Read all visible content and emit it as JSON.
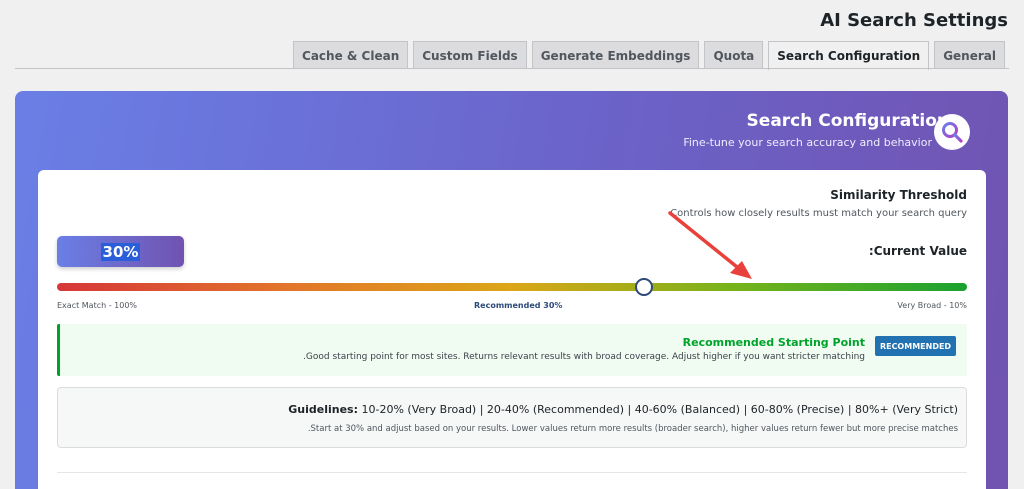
{
  "page": {
    "title": "AI Search Settings"
  },
  "tabs": [
    {
      "label": "Cache & Clean",
      "active": false
    },
    {
      "label": "Custom Fields",
      "active": false
    },
    {
      "label": "Generate Embeddings",
      "active": false
    },
    {
      "label": "Quota",
      "active": false
    },
    {
      "label": "Search Configuration",
      "active": true
    },
    {
      "label": "General",
      "active": false
    }
  ],
  "card": {
    "title": "Search Configuration",
    "subtitle": "Fine-tune your search accuracy and behavior",
    "icon": "search-icon"
  },
  "threshold": {
    "title": "Similarity Threshold",
    "description": "Controls how closely results must match your search query",
    "current_value_label": ":Current Value",
    "value_display": "30%",
    "value": 30,
    "min_label": "Exact Match - 100%",
    "recommended_label": "Recommended 30%",
    "max_label": "Very Broad - 10%"
  },
  "recommendation": {
    "title": "Recommended Starting Point",
    "description": ".Good starting point for most sites. Returns relevant results with broad coverage. Adjust higher if you want stricter matching",
    "badge": "RECOMMENDED"
  },
  "guidelines": {
    "label": "Guidelines:",
    "text": "10-20% (Very Broad) | 20-40% (Recommended) | 40-60% (Balanced) | 60-80% (Precise) | 80%+ (Very Strict)",
    "description": ".Start at 30% and adjust based on your results. Lower values return more results (broader search), higher values return fewer but more precise matches"
  },
  "colors": {
    "accent_start": "#6a7fe6",
    "accent_end": "#7153b0",
    "success": "#00a32a",
    "primary": "#2271b1",
    "annotation_arrow": "#e8413c"
  }
}
